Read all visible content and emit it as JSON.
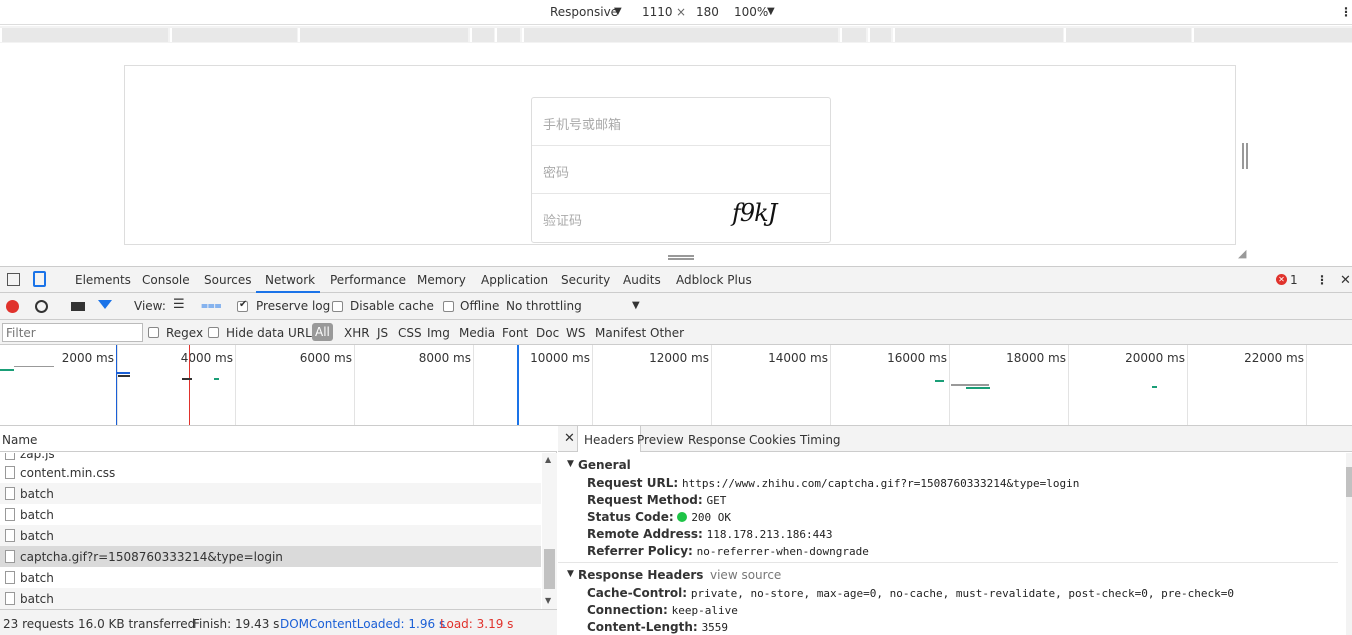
{
  "device_toolbar": {
    "mode": "Responsive",
    "width": "1110",
    "times": "×",
    "height": "180",
    "zoom": "100%"
  },
  "page": {
    "fields": [
      "手机号或邮箱",
      "密码",
      "验证码"
    ],
    "captcha": "f9kJ"
  },
  "devtools": {
    "tabs": [
      "Elements",
      "Console",
      "Sources",
      "Network",
      "Performance",
      "Memory",
      "Application",
      "Security",
      "Audits",
      "Adblock Plus"
    ],
    "active_tab": "Network",
    "error_count": "1"
  },
  "network_toolbar": {
    "view_label": "View:",
    "preserve_log": "Preserve log",
    "disable_cache": "Disable cache",
    "offline": "Offline",
    "throttling": "No throttling"
  },
  "filter_bar": {
    "placeholder": "Filter",
    "regex": "Regex",
    "hide_data_urls": "Hide data URLs",
    "types": [
      "All",
      "XHR",
      "JS",
      "CSS",
      "Img",
      "Media",
      "Font",
      "Doc",
      "WS",
      "Manifest",
      "Other"
    ]
  },
  "overview": {
    "ticks": [
      "2000 ms",
      "4000 ms",
      "6000 ms",
      "8000 ms",
      "10000 ms",
      "12000 ms",
      "14000 ms",
      "16000 ms",
      "18000 ms",
      "20000 ms",
      "22000 ms"
    ]
  },
  "requests": {
    "header": "Name",
    "rows": [
      "zap.js",
      "content.min.css",
      "batch",
      "batch",
      "batch",
      "captcha.gif?r=1508760333214&type=login",
      "batch",
      "batch"
    ],
    "selected_index": 5
  },
  "detail": {
    "tabs": [
      "Headers",
      "Preview",
      "Response",
      "Cookies",
      "Timing"
    ],
    "active_tab": "Headers",
    "general_title": "General",
    "general": [
      {
        "k": "Request URL:",
        "v": "https://www.zhihu.com/captcha.gif?r=1508760333214&type=login"
      },
      {
        "k": "Request Method:",
        "v": "GET"
      },
      {
        "k": "Status Code:",
        "v": "200 OK"
      },
      {
        "k": "Remote Address:",
        "v": "118.178.213.186:443"
      },
      {
        "k": "Referrer Policy:",
        "v": "no-referrer-when-downgrade"
      }
    ],
    "response_title": "Response Headers",
    "view_source": "view source",
    "response": [
      {
        "k": "Cache-Control:",
        "v": "private, no-store, max-age=0, no-cache, must-revalidate, post-check=0, pre-check=0"
      },
      {
        "k": "Connection:",
        "v": "keep-alive"
      },
      {
        "k": "Content-Length:",
        "v": "3559"
      }
    ]
  },
  "status": {
    "requests": "23 requests",
    "transferred": "16.0 KB transferred",
    "finish": "Finish: 19.43 s",
    "dcl": "DOMContentLoaded: 1.96 s",
    "load": "Load: 3.19 s"
  },
  "colors": {
    "record": "#e0322c",
    "dcl": "#1a5fd6",
    "load": "#e0322c",
    "status_ok": "#1ec447",
    "accent": "#0f88eb"
  }
}
